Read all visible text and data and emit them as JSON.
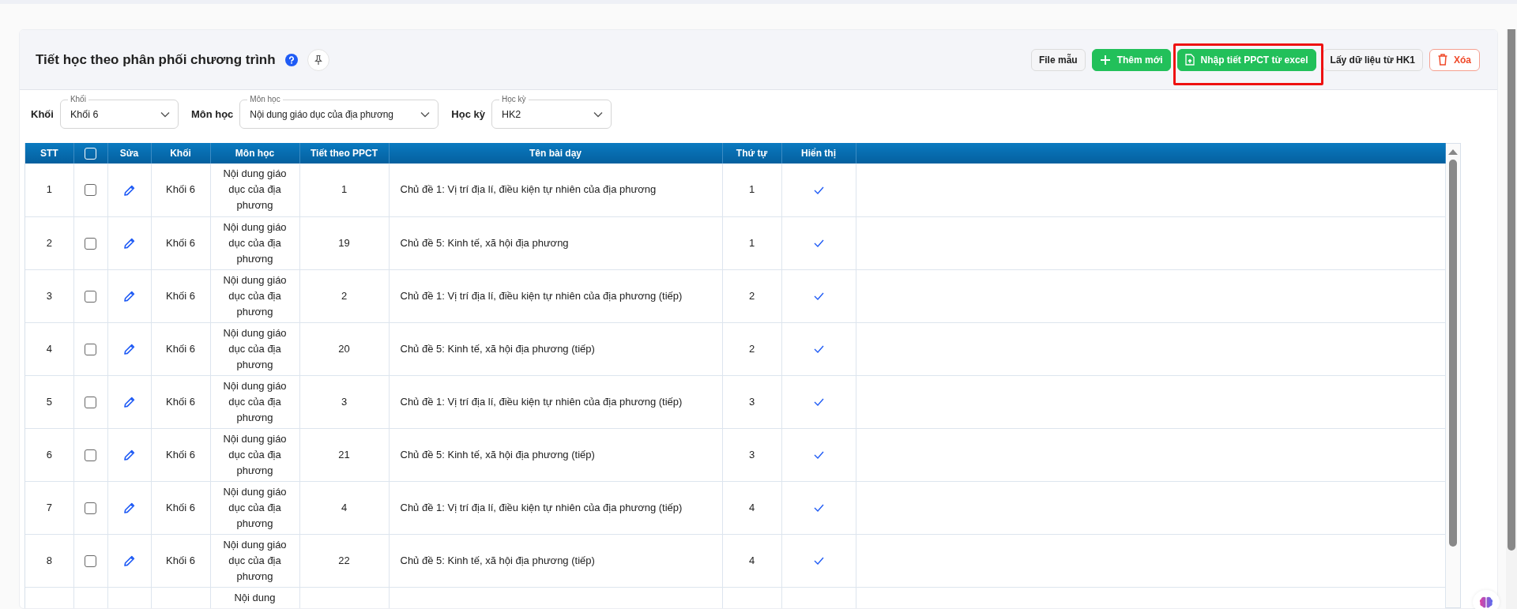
{
  "page": {
    "title": "Tiết học theo phân phối chương trình"
  },
  "toolbar": {
    "buttons": [
      {
        "kind": "plain",
        "label": "File mẫu",
        "highlighted": false
      },
      {
        "kind": "add",
        "label": "Thêm mới",
        "highlighted": false
      },
      {
        "kind": "import",
        "label": "Nhập tiết PPCT từ excel",
        "highlighted": true
      },
      {
        "kind": "plain",
        "label": "Lấy dữ liệu từ HK1",
        "highlighted": false
      },
      {
        "kind": "delete",
        "label": "Xóa",
        "highlighted": false
      }
    ]
  },
  "filters": [
    {
      "label": "Khối",
      "floating_label": "Khối",
      "value": "Khối 6"
    },
    {
      "label": "Môn học",
      "floating_label": "Môn học",
      "value": "Nội dung giáo dục của địa phương"
    },
    {
      "label": "Học kỳ",
      "floating_label": "Học kỳ",
      "value": "HK2"
    }
  ],
  "table": {
    "columns": [
      {
        "kind": "text",
        "label": "STT"
      },
      {
        "kind": "checkbox",
        "checked": false
      },
      {
        "kind": "text",
        "label": "Sửa"
      },
      {
        "kind": "text",
        "label": "Khối"
      },
      {
        "kind": "text",
        "label": "Môn học"
      },
      {
        "kind": "text",
        "label": "Tiết theo PPCT"
      },
      {
        "kind": "text",
        "label": "Tên bài dạy"
      },
      {
        "kind": "text",
        "label": "Thứ tự"
      },
      {
        "kind": "text",
        "label": "Hiển thị"
      }
    ],
    "rows": [
      {
        "stt": "1",
        "checked": false,
        "khoi": "Khối 6",
        "mon_hoc": "Nội dung giáo dục của địa phương",
        "tiet": "1",
        "ten_bai": "Chủ đề 1: Vị trí địa lí, điều kiện tự nhiên của địa phương",
        "thu_tu": "1",
        "hien_thi": true
      },
      {
        "stt": "2",
        "checked": false,
        "khoi": "Khối 6",
        "mon_hoc": "Nội dung giáo dục của địa phương",
        "tiet": "19",
        "ten_bai": "Chủ đề 5: Kinh tế, xã hội địa phương",
        "thu_tu": "1",
        "hien_thi": true
      },
      {
        "stt": "3",
        "checked": false,
        "khoi": "Khối 6",
        "mon_hoc": "Nội dung giáo dục của địa phương",
        "tiet": "2",
        "ten_bai": "Chủ đề 1: Vị trí địa lí, điều kiện tự nhiên của địa phương (tiếp)",
        "thu_tu": "2",
        "hien_thi": true
      },
      {
        "stt": "4",
        "checked": false,
        "khoi": "Khối 6",
        "mon_hoc": "Nội dung giáo dục của địa phương",
        "tiet": "20",
        "ten_bai": "Chủ đề 5: Kinh tế, xã hội địa phương (tiếp)",
        "thu_tu": "2",
        "hien_thi": true
      },
      {
        "stt": "5",
        "checked": false,
        "khoi": "Khối 6",
        "mon_hoc": "Nội dung giáo dục của địa phương",
        "tiet": "3",
        "ten_bai": "Chủ đề 1: Vị trí địa lí, điều kiện tự nhiên của địa phương (tiếp)",
        "thu_tu": "3",
        "hien_thi": true
      },
      {
        "stt": "6",
        "checked": false,
        "khoi": "Khối 6",
        "mon_hoc": "Nội dung giáo dục của địa phương",
        "tiet": "21",
        "ten_bai": "Chủ đề 5: Kinh tế, xã hội địa phương (tiếp)",
        "thu_tu": "3",
        "hien_thi": true
      },
      {
        "stt": "7",
        "checked": false,
        "khoi": "Khối 6",
        "mon_hoc": "Nội dung giáo dục của địa phương",
        "tiet": "4",
        "ten_bai": "Chủ đề 1: Vị trí địa lí, điều kiện tự nhiên của địa phương (tiếp)",
        "thu_tu": "4",
        "hien_thi": true
      },
      {
        "stt": "8",
        "checked": false,
        "khoi": "Khối 6",
        "mon_hoc": "Nội dung giáo dục của địa phương",
        "tiet": "22",
        "ten_bai": "Chủ đề 5: Kinh tế, xã hội địa phương (tiếp)",
        "thu_tu": "4",
        "hien_thi": true
      }
    ],
    "partial_row": {
      "mon_hoc": "Nội dung"
    }
  }
}
